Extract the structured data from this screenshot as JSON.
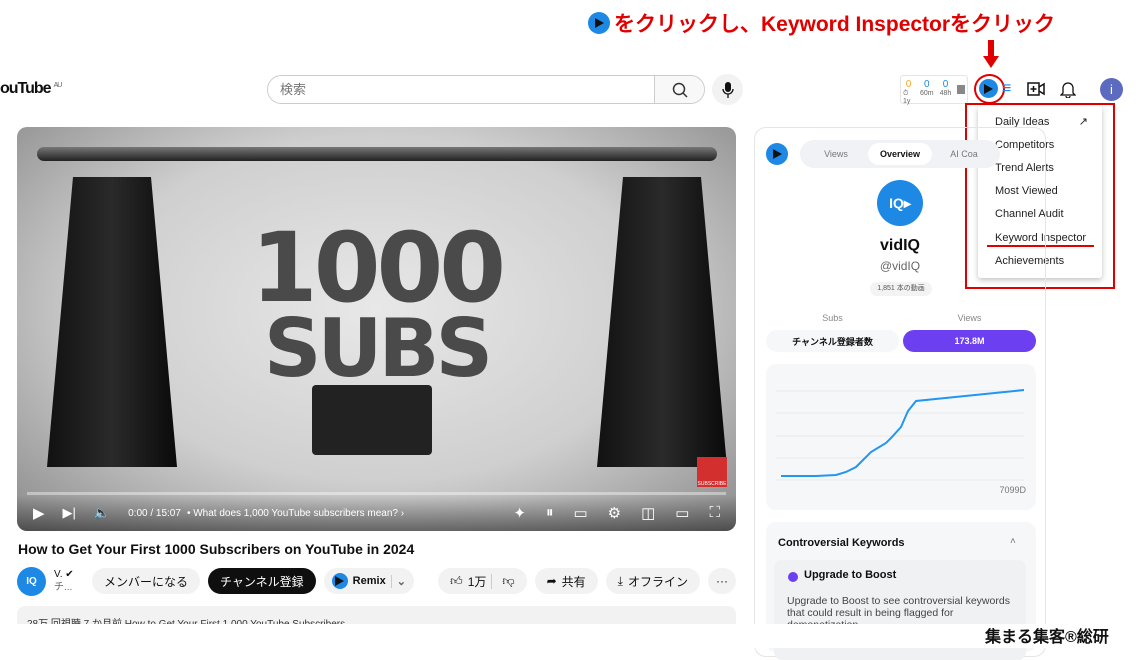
{
  "annotation": {
    "text": "をクリックし、Keyword Inspectorをクリック",
    "color": "#e00000"
  },
  "header": {
    "logo": "ouTube",
    "region": "AU",
    "search_placeholder": "検索",
    "stats": [
      {
        "value": "0",
        "label": "⏱1y",
        "color": "#f9a825"
      },
      {
        "value": "0",
        "label": "60m",
        "color": "#1e88e5"
      },
      {
        "value": "0",
        "label": "48h",
        "color": "#1e88e5"
      }
    ],
    "avatar_letter": "i"
  },
  "dropdown": {
    "items": [
      "Daily Ideas",
      "Competitors",
      "Trend Alerts",
      "Most Viewed",
      "Channel Audit",
      "Keyword Inspector",
      "Achievements"
    ],
    "highlighted": "Keyword Inspector"
  },
  "video": {
    "overlay_line1": "1000",
    "overlay_line2": "SUBS",
    "time": "0:00 / 15:07",
    "chapter": "• What does 1,000 YouTube subscribers mean? ›",
    "badge": "SUBSCRIBE"
  },
  "title": "How to Get Your First 1000 Subscribers on YouTube in 2024",
  "channel": {
    "avatar": "IQ",
    "name": "V. ✔",
    "subs": "チ...",
    "join": "メンバーになる",
    "subscribe": "チャンネル登録",
    "remix": "Remix",
    "likes": "1万",
    "share": "共有",
    "offline": "オフライン",
    "more": "···"
  },
  "description": {
    "text": "28万 回視聴  7 か月前  How to Get Your First 1,000 YouTube Subscribers"
  },
  "sidebar": {
    "tabs": [
      "Views",
      "Overview",
      "AI Coa"
    ],
    "active_tab": "Overview",
    "channel_name": "vidIQ",
    "handle": "@vidIQ",
    "video_count": "1,851 本の動画",
    "subs_label": "Subs",
    "views_label": "Views",
    "subs_value": "チャンネル登録者数",
    "views_value": "173.8M",
    "chart_label": "7099D",
    "kw_title": "Controversial Keywords",
    "upgrade_title": "Upgrade to Boost",
    "upgrade_text": "Upgrade to Boost to see controversial keywords that could result in being flagged for demonetization",
    "accent": "#6c3ff0",
    "line_color": "#2196f3"
  },
  "brand": "集まる集客®総研"
}
